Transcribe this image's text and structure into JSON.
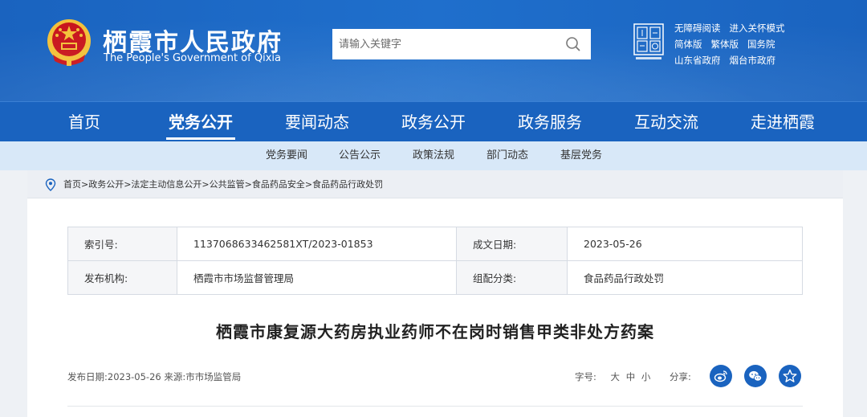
{
  "header": {
    "title": "栖霞市人民政府",
    "subtitle": "The People's Government of Qixia",
    "search_placeholder": "请输入关键字",
    "links_row1": [
      "无障碍阅读",
      "进入关怀模式"
    ],
    "links_row2": [
      "简体版",
      "繁体版",
      "国务院"
    ],
    "links_row3": [
      "山东省政府",
      "烟台市政府"
    ]
  },
  "mainnav": {
    "items": [
      "首页",
      "党务公开",
      "要闻动态",
      "政务公开",
      "政务服务",
      "互动交流",
      "走进栖霞"
    ],
    "active": "党务公开"
  },
  "subnav": {
    "items": [
      "党务要闻",
      "公告公示",
      "政策法规",
      "部门动态",
      "基层党务"
    ]
  },
  "breadcrumb": "首页>政务公开>法定主动信息公开>公共监管>食品药品安全>食品药品行政处罚",
  "meta": {
    "index_label": "索引号:",
    "index_value": "1137068633462581XT/2023-01853",
    "date_label": "成文日期:",
    "date_value": "2023-05-26",
    "org_label": "发布机构:",
    "org_value": "栖霞市市场监督管理局",
    "category_label": "组配分类:",
    "category_value": "食品药品行政处罚"
  },
  "article": {
    "title": "栖霞市康复源大药房执业药师不在岗时销售甲类非处方药案",
    "pubinfo": "发布日期:2023-05-26 来源:市市场监管局",
    "fontsize_label": "字号:",
    "fontsize_large": "大",
    "fontsize_medium": "中",
    "fontsize_small": "小",
    "share_label": "分享:"
  },
  "colors": {
    "brand_blue": "#1a63bf",
    "subnav_bg": "#d8e8f8",
    "emblem_red": "#c8161d",
    "emblem_gold": "#f3c13a"
  },
  "icons": {
    "search": "search-icon",
    "location": "location-pin-icon",
    "share": [
      "weibo-icon",
      "wechat-icon",
      "qzone-star-icon"
    ]
  }
}
